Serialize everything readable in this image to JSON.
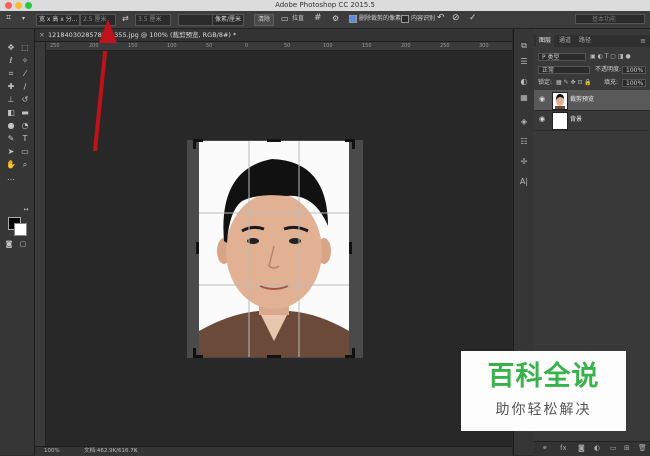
{
  "app": {
    "title": "Adobe Photoshop CC 2015.5"
  },
  "options_bar": {
    "ratio_select": "宽 x 高 x 分...",
    "width_field": "2.5 厘米",
    "swap_icon": "swap-arrows-icon",
    "height_field": "3.5 厘米",
    "resolution_field": "",
    "resolution_unit": "像素/厘米",
    "clear_button": "清除",
    "straighten_button": "拉直",
    "delete_cropped_label": "删除裁剪的像素",
    "content_aware_label": "内容识别",
    "workspace": "基本功能"
  },
  "document": {
    "tab_title": "1218403028578824355.jpg @ 100% (裁剪预览, RGB/8#) *",
    "zoom": "100%",
    "doc_info": "文档:462.9K/616.7K",
    "ruler_h_labels": [
      "250",
      "200",
      "150",
      "100",
      "50",
      "0",
      "50",
      "100",
      "150",
      "200",
      "250",
      "300"
    ]
  },
  "panels": {
    "tabs": [
      "图层",
      "通道",
      "路径"
    ],
    "kind_filter": "P 类型",
    "blend_mode": "正常",
    "opacity_label": "不透明度:",
    "opacity_value": "100%",
    "lock_label": "锁定:",
    "fill_label": "填充:",
    "fill_value": "100%",
    "layers": [
      {
        "name": "裁剪预览",
        "selected": true
      },
      {
        "name": "背景",
        "selected": false
      }
    ]
  },
  "watermark": {
    "title": "百科全说",
    "subtitle": "助你轻松解决"
  },
  "colors": {
    "annotation_arrow": "#c0121a",
    "watermark_green": "#38b24a"
  }
}
